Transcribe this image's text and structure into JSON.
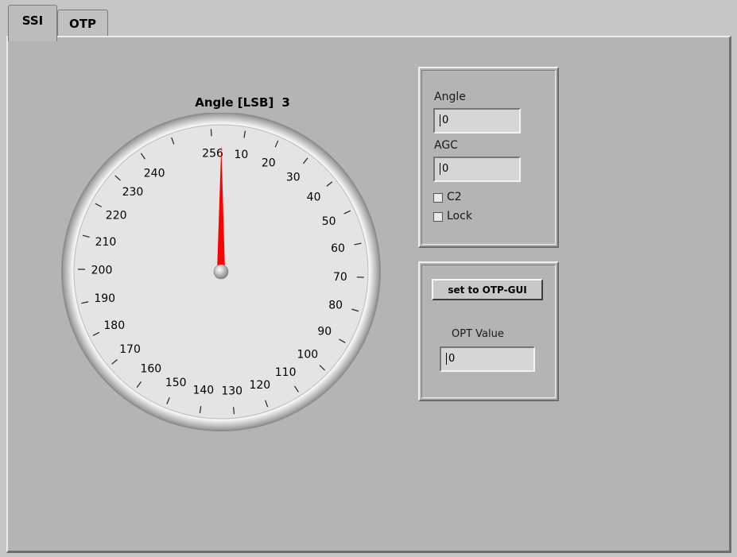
{
  "tabs": [
    {
      "label": "SSI",
      "active": true
    },
    {
      "label": "OTP",
      "active": false
    }
  ],
  "gauge": {
    "title": "Angle [LSB]",
    "value_display": "3",
    "value": 3,
    "max": 256,
    "needle_color": "#ff0000",
    "tick_labels": [
      "256",
      "10",
      "20",
      "30",
      "40",
      "50",
      "60",
      "70",
      "80",
      "90",
      "100",
      "110",
      "120",
      "130",
      "140",
      "150",
      "160",
      "170",
      "180",
      "190",
      "200",
      "210",
      "220",
      "230",
      "240"
    ]
  },
  "readout_panel": {
    "angle_label": "Angle",
    "angle_value": "0",
    "agc_label": "AGC",
    "agc_value": "0",
    "c2_label": "C2",
    "c2_checked": false,
    "lock_label": "Lock",
    "lock_checked": false
  },
  "otp_panel": {
    "button_label": "set to OTP-GUI",
    "opt_label": "OPT Value",
    "opt_value": "0"
  }
}
